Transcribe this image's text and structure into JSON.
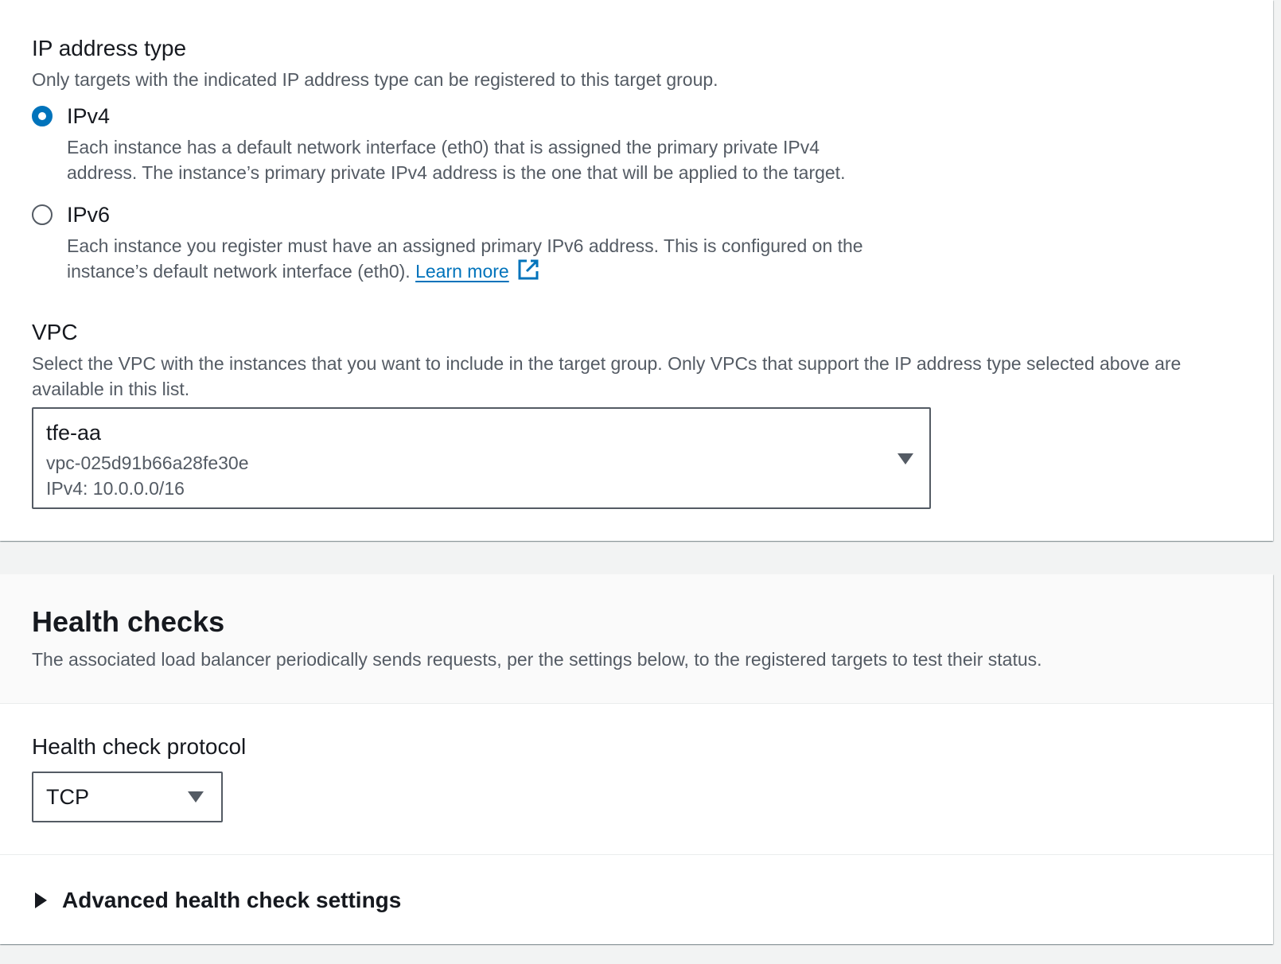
{
  "ip_address_type": {
    "label": "IP address type",
    "description": "Only targets with the indicated IP address type can be registered to this target group.",
    "options": [
      {
        "label": "IPv4",
        "selected": true,
        "description_line1": "Each instance has a default network interface (eth0) that is assigned the primary private IPv4",
        "description_line2": "address. The instance’s primary private IPv4 address is the one that will be applied to the target."
      },
      {
        "label": "IPv6",
        "selected": false,
        "description_line1": "Each instance you register must have an assigned primary IPv6 address. This is configured on the",
        "description_line2": "instance’s default network interface (eth0).",
        "link_text": "Learn more"
      }
    ]
  },
  "vpc": {
    "label": "VPC",
    "description": "Select the VPC with the instances that you want to include in the target group. Only VPCs that support the IP address type selected above are available in this list.",
    "selected": {
      "name": "tfe-aa",
      "id": "vpc-025d91b66a28fe30e",
      "cidr": "IPv4: 10.0.0.0/16"
    }
  },
  "health_checks": {
    "title": "Health checks",
    "description": "The associated load balancer periodically sends requests, per the settings below, to the registered targets to test their status.",
    "protocol_label": "Health check protocol",
    "protocol_value": "TCP",
    "advanced_label": "Advanced health check settings"
  },
  "icons": {
    "external_link": "external-link-icon",
    "dropdown": "caret-down-icon",
    "expander": "caret-right-icon"
  },
  "colors": {
    "accent": "#0073bb",
    "text_primary": "#16191f",
    "text_secondary": "#545b64",
    "page_background": "#f2f3f3"
  }
}
